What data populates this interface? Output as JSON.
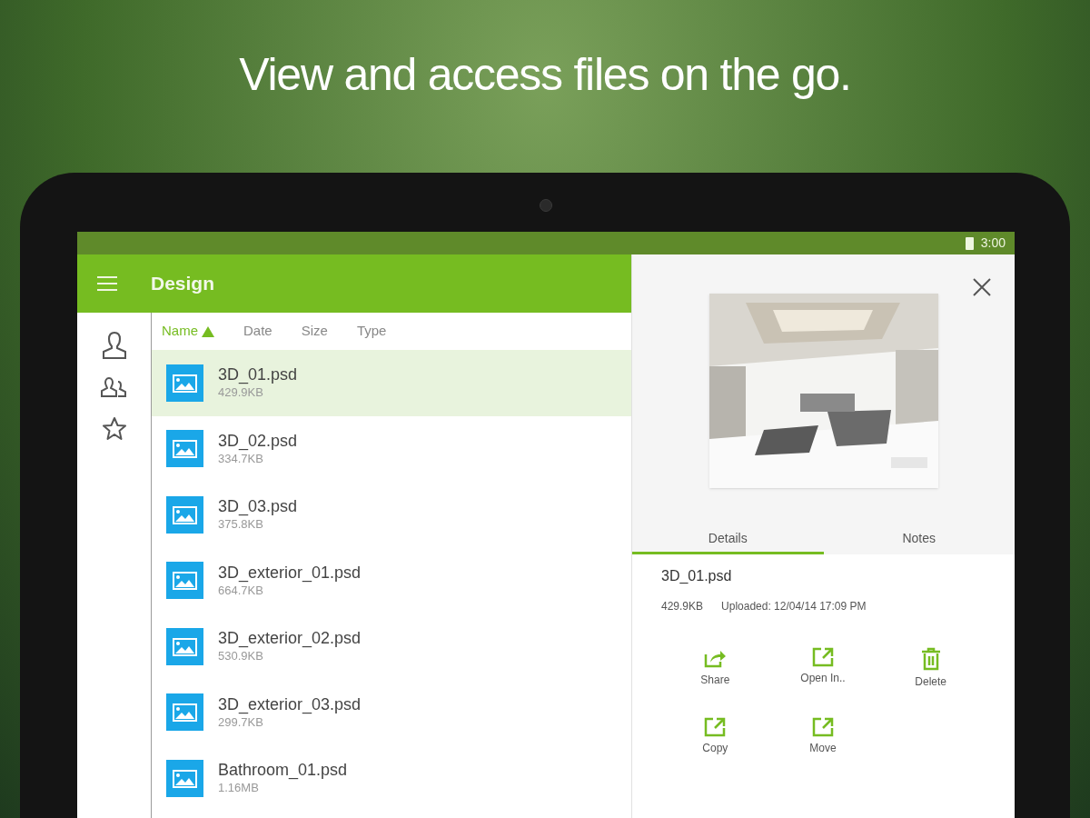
{
  "headline": "View and access files on the go.",
  "status_bar": {
    "time": "3:00"
  },
  "app_bar": {
    "title": "Design"
  },
  "sort_columns": [
    {
      "label": "Name",
      "selected": true
    },
    {
      "label": "Date",
      "selected": false
    },
    {
      "label": "Size",
      "selected": false
    },
    {
      "label": "Type",
      "selected": false
    }
  ],
  "files": [
    {
      "name": "3D_01.psd",
      "size": "429.9KB",
      "selected": true
    },
    {
      "name": "3D_02.psd",
      "size": "334.7KB",
      "selected": false
    },
    {
      "name": "3D_03.psd",
      "size": "375.8KB",
      "selected": false
    },
    {
      "name": "3D_exterior_01.psd",
      "size": "664.7KB",
      "selected": false
    },
    {
      "name": "3D_exterior_02.psd",
      "size": "530.9KB",
      "selected": false
    },
    {
      "name": "3D_exterior_03.psd",
      "size": "299.7KB",
      "selected": false
    },
    {
      "name": "Bathroom_01.psd",
      "size": "1.16MB",
      "selected": false
    }
  ],
  "details": {
    "tabs": [
      {
        "label": "Details",
        "selected": true
      },
      {
        "label": "Notes",
        "selected": false
      }
    ],
    "file_name": "3D_01.psd",
    "size": "429.9KB",
    "uploaded": "Uploaded: 12/04/14 17:09 PM",
    "actions": [
      {
        "label": "Share",
        "kind": "share"
      },
      {
        "label": "Open In..",
        "kind": "open"
      },
      {
        "label": "Delete",
        "kind": "delete"
      },
      {
        "label": "Copy",
        "kind": "open"
      },
      {
        "label": "Move",
        "kind": "open"
      }
    ]
  }
}
